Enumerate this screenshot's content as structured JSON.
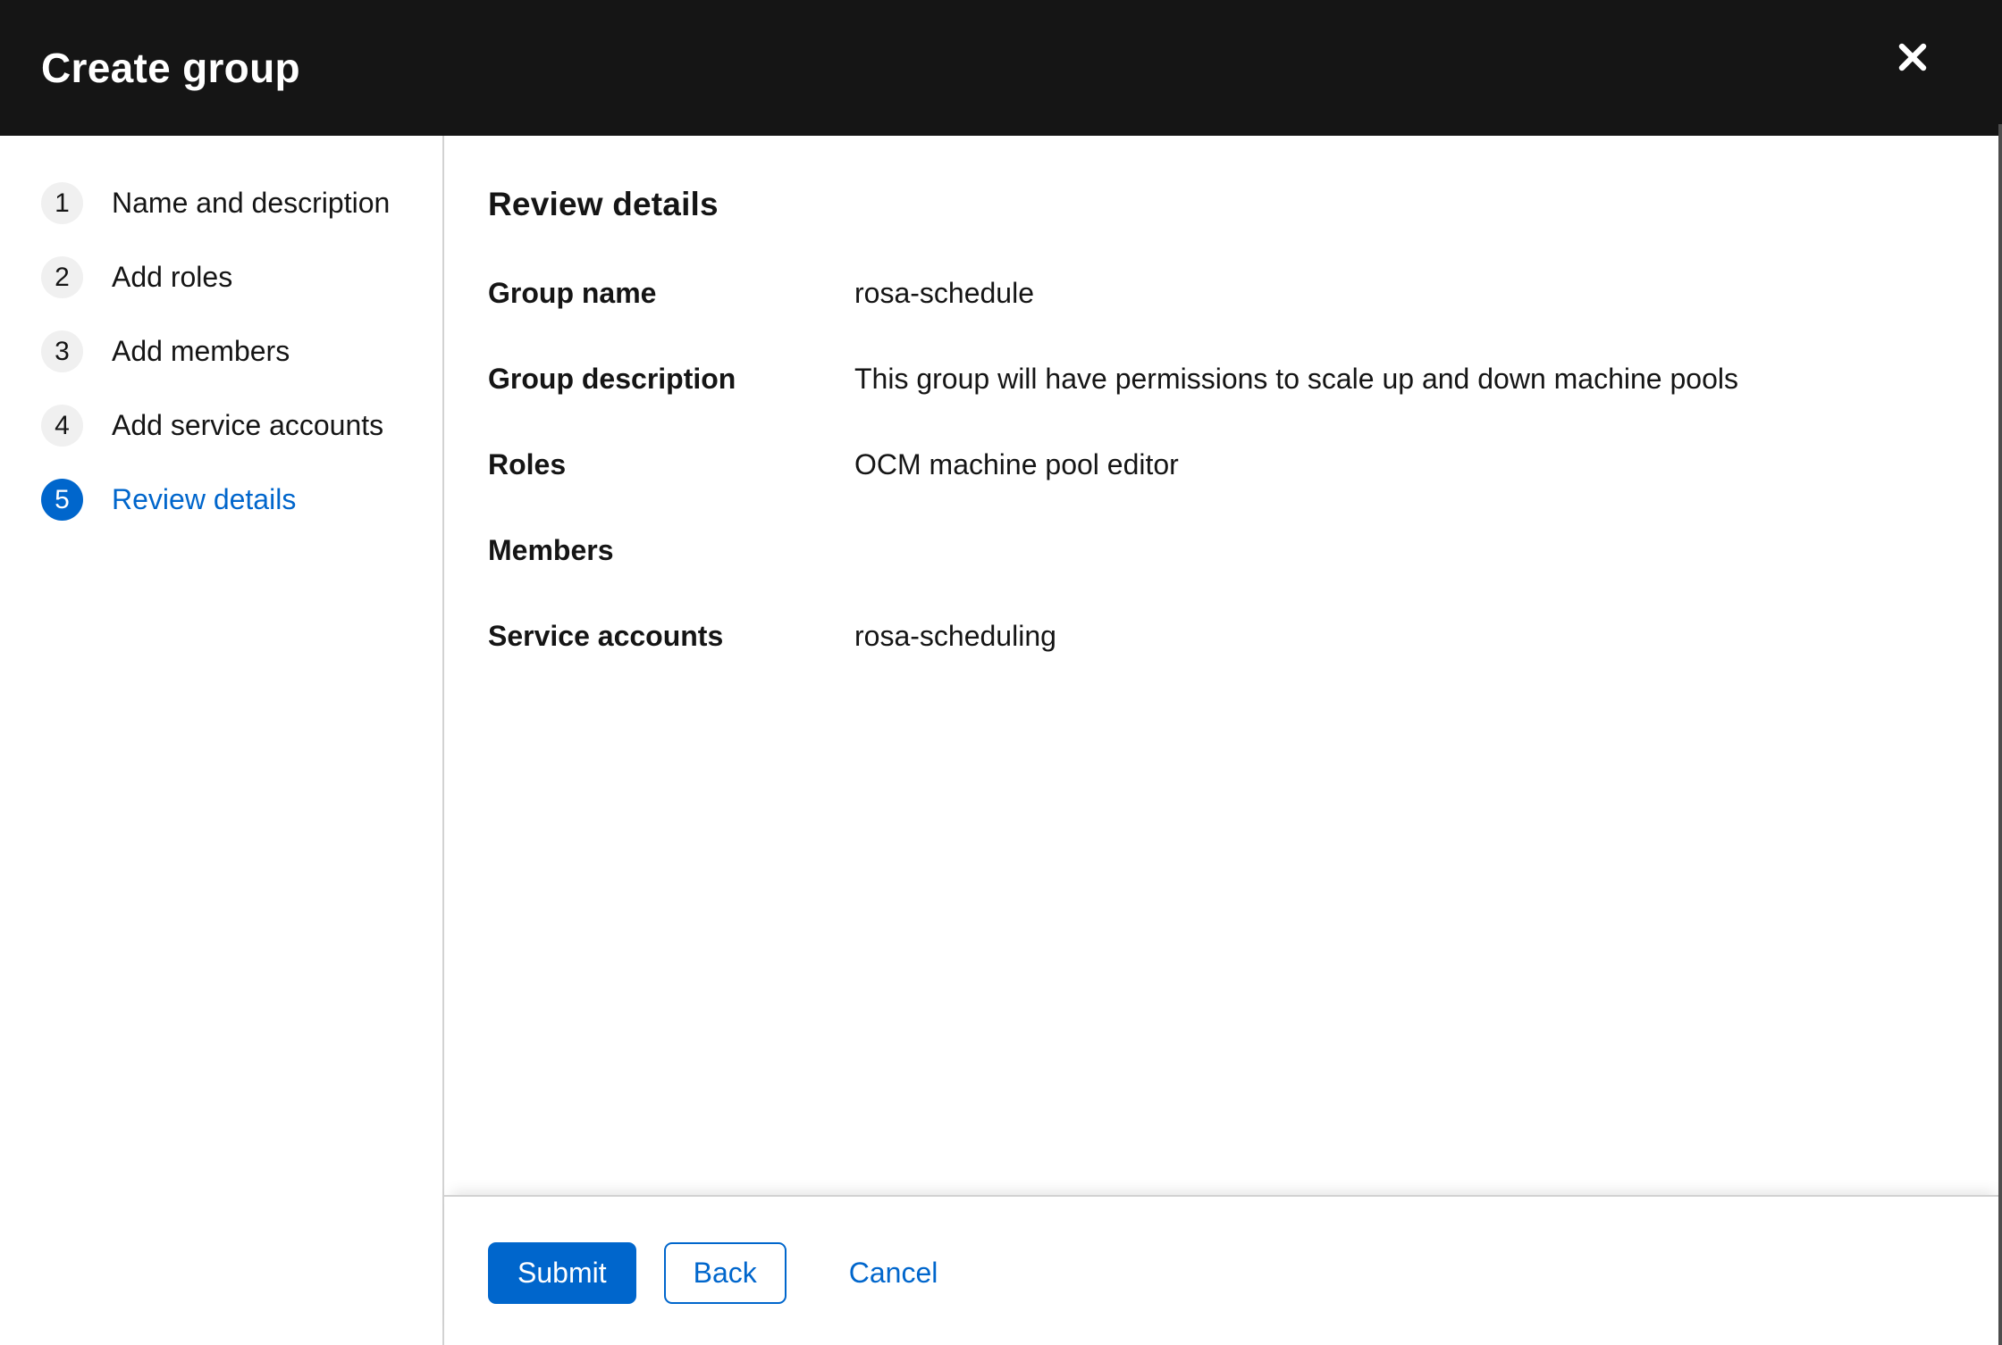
{
  "modal": {
    "title": "Create group",
    "close_icon": "times-icon"
  },
  "wizard_nav": {
    "steps": [
      {
        "number": "1",
        "label": "Name and description",
        "active": false
      },
      {
        "number": "2",
        "label": "Add roles",
        "active": false
      },
      {
        "number": "3",
        "label": "Add members",
        "active": false
      },
      {
        "number": "4",
        "label": "Add service accounts",
        "active": false
      },
      {
        "number": "5",
        "label": "Review details",
        "active": true
      }
    ]
  },
  "review": {
    "heading": "Review details",
    "fields": [
      {
        "label": "Group name",
        "value": "rosa-schedule"
      },
      {
        "label": "Group description",
        "value": "This group will have permissions to scale up and down machine pools"
      },
      {
        "label": "Roles",
        "value": "OCM machine pool editor"
      },
      {
        "label": "Members",
        "value": ""
      },
      {
        "label": "Service accounts",
        "value": "rosa-scheduling"
      }
    ]
  },
  "footer": {
    "submit_label": "Submit",
    "back_label": "Back",
    "cancel_label": "Cancel"
  },
  "colors": {
    "primary": "#0066cc",
    "header_bg": "#151515",
    "text": "#151515",
    "divider": "#d2d2d2",
    "inactive_step_bg": "#f0f0f0",
    "active_step_bg": "#0066cc",
    "scrollbar": "#4d4d4d"
  }
}
